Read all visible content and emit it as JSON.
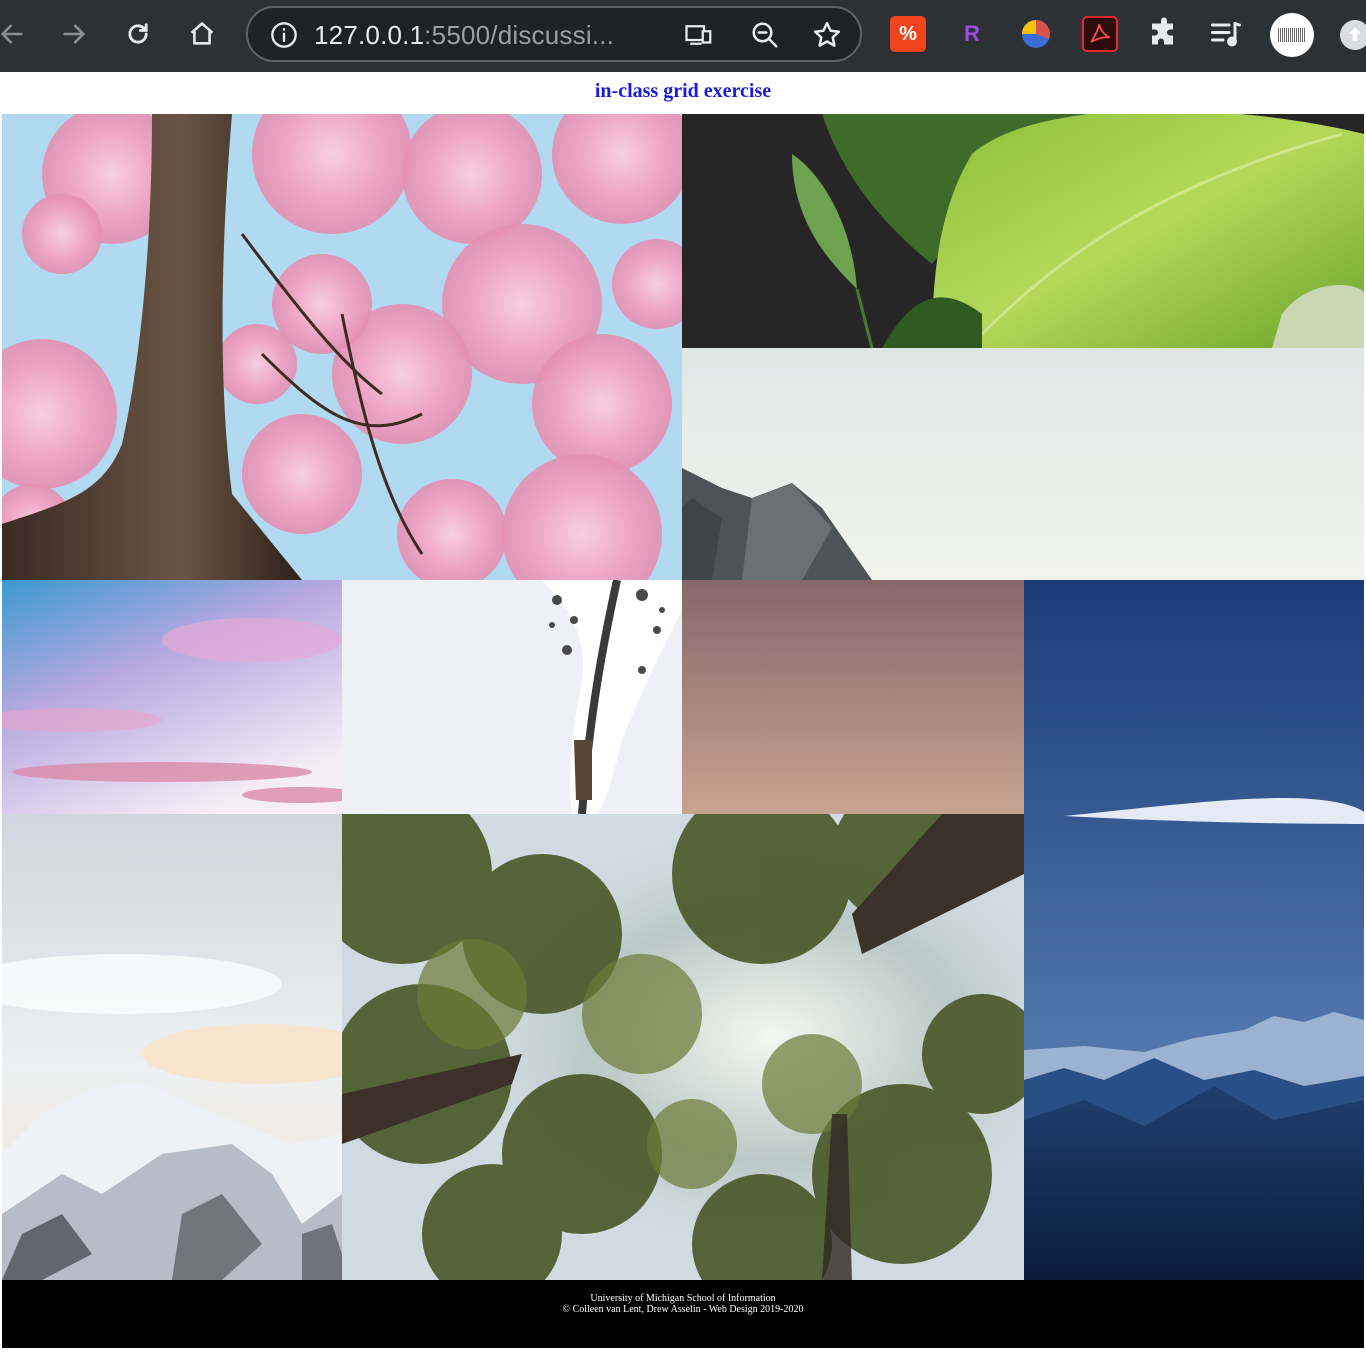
{
  "browser": {
    "url_host": "127.0.0.1",
    "url_rest": ":5500/discussi..."
  },
  "page": {
    "title": "in-class grid exercise"
  },
  "footer": {
    "line1": "University of Michigan School of Information",
    "line2": "© Colleen van Lent, Drew Asselin - Web Design 2019-2020"
  },
  "extensions": {
    "reader_label": "R"
  }
}
